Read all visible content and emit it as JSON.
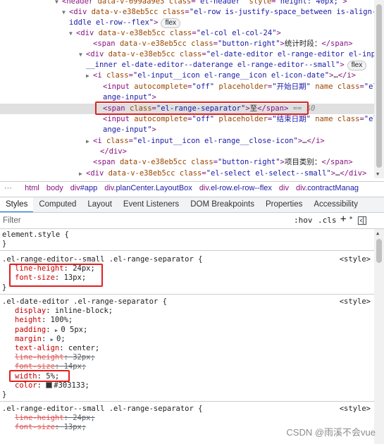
{
  "dom_tree": {
    "lines": [
      {
        "segments": [
          {
            "c": "tok-tag",
            "t": "<header "
          },
          {
            "c": "tok-attr",
            "t": "data-v-699aa9e3 "
          },
          {
            "c": "tok-attr",
            "t": "class"
          },
          {
            "c": "tok-tag",
            "t": "="
          },
          {
            "c": "tok-val",
            "t": "\"el-header\""
          },
          {
            "c": "tok-attr",
            "t": " style"
          },
          {
            "c": "tok-tag",
            "t": "="
          },
          {
            "c": "tok-val",
            "t": "\"height: 40px;\""
          },
          {
            "c": "tok-tag",
            "t": ">"
          }
        ]
      },
      {
        "segments": [
          {
            "c": "tok-tag",
            "t": "<div "
          },
          {
            "c": "tok-attr",
            "t": "data-v-e38eb5cc "
          },
          {
            "c": "tok-attr",
            "t": "class"
          },
          {
            "c": "tok-tag",
            "t": "="
          },
          {
            "c": "tok-val",
            "t": "\"el-row is-justify-space_between is-align-m"
          }
        ]
      },
      {
        "segments": [
          {
            "c": "tok-val",
            "t": "iddle el-row--flex\""
          },
          {
            "c": "tok-tag",
            "t": ">"
          }
        ]
      },
      {
        "segments": [
          {
            "c": "tok-tag",
            "t": "<div "
          },
          {
            "c": "tok-attr",
            "t": "data-v-e38eb5cc "
          },
          {
            "c": "tok-attr",
            "t": "class"
          },
          {
            "c": "tok-tag",
            "t": "="
          },
          {
            "c": "tok-val",
            "t": "\"el-col el-col-24\""
          },
          {
            "c": "tok-tag",
            "t": ">"
          }
        ]
      },
      {
        "segments": [
          {
            "c": "tok-tag",
            "t": "<span "
          },
          {
            "c": "tok-attr",
            "t": "data-v-e38eb5cc "
          },
          {
            "c": "tok-attr",
            "t": "class"
          },
          {
            "c": "tok-tag",
            "t": "="
          },
          {
            "c": "tok-val",
            "t": "\"button-right\""
          },
          {
            "c": "tok-tag",
            "t": ">"
          },
          {
            "c": "tok-txt",
            "t": "统计时段："
          },
          {
            "c": "tok-tag",
            "t": "</span>"
          }
        ]
      },
      {
        "segments": [
          {
            "c": "tok-tag",
            "t": "<div "
          },
          {
            "c": "tok-attr",
            "t": "data-v-e38eb5cc "
          },
          {
            "c": "tok-attr",
            "t": "class"
          },
          {
            "c": "tok-tag",
            "t": "="
          },
          {
            "c": "tok-val",
            "t": "\"el-date-editor el-range-editor el-input"
          }
        ]
      },
      {
        "segments": [
          {
            "c": "tok-val",
            "t": "__inner el-date-editor--daterange el-range-editor--small\""
          },
          {
            "c": "tok-tag",
            "t": ">"
          }
        ]
      },
      {
        "segments": [
          {
            "c": "tok-tag",
            "t": "<i "
          },
          {
            "c": "tok-attr",
            "t": "class"
          },
          {
            "c": "tok-tag",
            "t": "="
          },
          {
            "c": "tok-val",
            "t": "\"el-input__icon el-range__icon el-icon-date\""
          },
          {
            "c": "tok-tag",
            "t": ">"
          },
          {
            "c": "tok-txt",
            "t": "…"
          },
          {
            "c": "tok-tag",
            "t": "</i>"
          }
        ]
      },
      {
        "segments": [
          {
            "c": "tok-tag",
            "t": "<input "
          },
          {
            "c": "tok-attr",
            "t": "autocomplete"
          },
          {
            "c": "tok-tag",
            "t": "="
          },
          {
            "c": "tok-val",
            "t": "\"off\""
          },
          {
            "c": "tok-attr",
            "t": " placeholder"
          },
          {
            "c": "tok-tag",
            "t": "="
          },
          {
            "c": "tok-val",
            "t": "\"开始日期\""
          },
          {
            "c": "tok-attr",
            "t": " name"
          },
          {
            "c": "tok-attr",
            "t": " class"
          },
          {
            "c": "tok-tag",
            "t": "="
          },
          {
            "c": "tok-val",
            "t": "\"el-r"
          }
        ]
      },
      {
        "segments": [
          {
            "c": "tok-val",
            "t": "ange-input\""
          },
          {
            "c": "tok-tag",
            "t": ">"
          }
        ]
      },
      {
        "segments": [
          {
            "c": "tok-tag",
            "t": "<span "
          },
          {
            "c": "tok-attr",
            "t": "class"
          },
          {
            "c": "tok-tag",
            "t": "="
          },
          {
            "c": "tok-val",
            "t": "\"el-range-separator\""
          },
          {
            "c": "tok-tag",
            "t": ">"
          },
          {
            "c": "tok-txt",
            "t": "至"
          },
          {
            "c": "tok-tag",
            "t": "</span>"
          },
          {
            "c": "tok-dim",
            "t": " == $0"
          }
        ]
      },
      {
        "segments": [
          {
            "c": "tok-tag",
            "t": "<input "
          },
          {
            "c": "tok-attr",
            "t": "autocomplete"
          },
          {
            "c": "tok-tag",
            "t": "="
          },
          {
            "c": "tok-val",
            "t": "\"off\""
          },
          {
            "c": "tok-attr",
            "t": " placeholder"
          },
          {
            "c": "tok-tag",
            "t": "="
          },
          {
            "c": "tok-val",
            "t": "\"结束日期\""
          },
          {
            "c": "tok-attr",
            "t": " name"
          },
          {
            "c": "tok-attr",
            "t": " class"
          },
          {
            "c": "tok-tag",
            "t": "="
          },
          {
            "c": "tok-val",
            "t": "\"el-r"
          }
        ]
      },
      {
        "segments": [
          {
            "c": "tok-val",
            "t": "ange-input\""
          },
          {
            "c": "tok-tag",
            "t": ">"
          }
        ]
      },
      {
        "segments": [
          {
            "c": "tok-tag",
            "t": "<i "
          },
          {
            "c": "tok-attr",
            "t": "class"
          },
          {
            "c": "tok-tag",
            "t": "="
          },
          {
            "c": "tok-val",
            "t": "\"el-input__icon el-range__close-icon\""
          },
          {
            "c": "tok-tag",
            "t": ">"
          },
          {
            "c": "tok-txt",
            "t": "…"
          },
          {
            "c": "tok-tag",
            "t": "</i>"
          }
        ]
      },
      {
        "segments": [
          {
            "c": "tok-tag",
            "t": "</div>"
          }
        ]
      },
      {
        "segments": [
          {
            "c": "tok-tag",
            "t": "<span "
          },
          {
            "c": "tok-attr",
            "t": "data-v-e38eb5cc "
          },
          {
            "c": "tok-attr",
            "t": "class"
          },
          {
            "c": "tok-tag",
            "t": "="
          },
          {
            "c": "tok-val",
            "t": "\"button-right\""
          },
          {
            "c": "tok-tag",
            "t": ">"
          },
          {
            "c": "tok-txt",
            "t": "项目类别："
          },
          {
            "c": "tok-tag",
            "t": "</span>"
          }
        ]
      },
      {
        "segments": [
          {
            "c": "tok-tag",
            "t": "<div "
          },
          {
            "c": "tok-attr",
            "t": "data-v-e38eb5cc "
          },
          {
            "c": "tok-attr",
            "t": "class"
          },
          {
            "c": "tok-tag",
            "t": "="
          },
          {
            "c": "tok-val",
            "t": "\"el-select el-select--small\""
          },
          {
            "c": "tok-tag",
            "t": ">"
          },
          {
            "c": "tok-txt",
            "t": "…"
          },
          {
            "c": "tok-tag",
            "t": "</div>"
          }
        ]
      }
    ],
    "badges": {
      "row_flex": "flex",
      "editor_flex": "flex"
    },
    "ellipsis": "···"
  },
  "breadcrumb": {
    "dots": "···",
    "items": [
      {
        "tag": "html",
        "cls": ""
      },
      {
        "tag": "body",
        "cls": ""
      },
      {
        "tag": "div",
        "cls": "#app"
      },
      {
        "tag": "div",
        "cls": ".planCenter.LayoutBox"
      },
      {
        "tag": "div",
        "cls": ".el-row.el-row--flex"
      },
      {
        "tag": "div",
        "cls": ""
      },
      {
        "tag": "div",
        "cls": ".contractManag"
      }
    ]
  },
  "tabs": [
    "Styles",
    "Computed",
    "Layout",
    "Event Listeners",
    "DOM Breakpoints",
    "Properties",
    "Accessibility"
  ],
  "filter": {
    "placeholder": "Filter",
    "hov": ":hov",
    "cls": ".cls",
    "plus": "+"
  },
  "rules": [
    {
      "selector": "element.style {",
      "source": "",
      "props": [],
      "close": "}"
    },
    {
      "selector": ".el-range-editor--small .el-range-separator {",
      "source": "<style>",
      "props": [
        {
          "name": "line-height",
          "value": "24px",
          "struck": false,
          "expand": false
        },
        {
          "name": "font-size",
          "value": "13px",
          "struck": false,
          "expand": false
        }
      ],
      "close": "}"
    },
    {
      "selector": ".el-date-editor .el-range-separator {",
      "source": "<style>",
      "props": [
        {
          "name": "display",
          "value": "inline-block",
          "struck": false,
          "expand": false
        },
        {
          "name": "height",
          "value": "100%",
          "struck": false,
          "expand": false
        },
        {
          "name": "padding",
          "value": "0 5px",
          "struck": false,
          "expand": true
        },
        {
          "name": "margin",
          "value": "0",
          "struck": false,
          "expand": true
        },
        {
          "name": "text-align",
          "value": "center",
          "struck": false,
          "expand": false
        },
        {
          "name": "line-height",
          "value": "32px",
          "struck": true,
          "expand": false
        },
        {
          "name": "font-size",
          "value": "14px",
          "struck": true,
          "expand": false
        },
        {
          "name": "width",
          "value": "5%",
          "struck": false,
          "expand": false
        },
        {
          "name": "color",
          "value": "#303133",
          "struck": false,
          "expand": false,
          "swatch": "#303133"
        }
      ],
      "close": "}"
    },
    {
      "selector": ".el-range-editor--small .el-range-separator {",
      "source": "<style>",
      "props": [
        {
          "name": "line-height",
          "value": "24px",
          "struck": true,
          "expand": false
        },
        {
          "name": "font-size",
          "value": "13px",
          "struck": true,
          "expand": false
        }
      ],
      "close": ""
    }
  ],
  "watermark": "CSDN @雨溪不会vue",
  "colors": {
    "highlight_box": "#e0201f",
    "active_tab": "#1a73e8"
  }
}
